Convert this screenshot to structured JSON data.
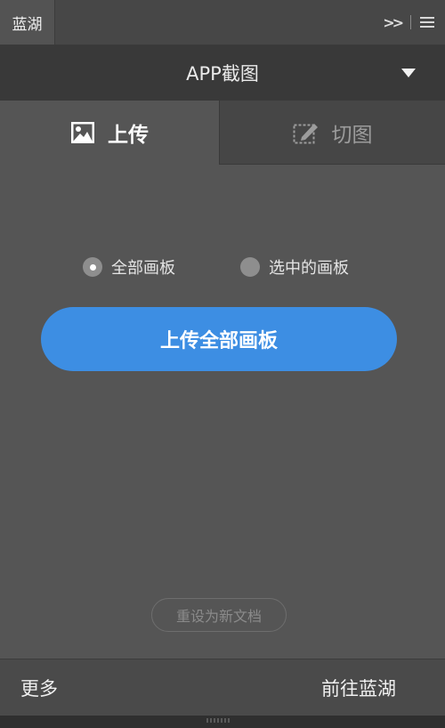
{
  "panel": {
    "tab_label": "蓝湖",
    "collapse_icon": "double-chevron-right-icon",
    "menu_icon": "hamburger-menu-icon"
  },
  "header": {
    "dropdown_label": "APP截图",
    "caret_icon": "caret-down-icon"
  },
  "mode_tabs": [
    {
      "label": "上传",
      "icon": "image-icon",
      "active": true
    },
    {
      "label": "切图",
      "icon": "slice-icon",
      "active": false
    }
  ],
  "options": {
    "selected": "全部画板",
    "items": [
      {
        "label": "全部画板",
        "checked": true
      },
      {
        "label": "选中的画板",
        "checked": false
      }
    ]
  },
  "actions": {
    "primary_label": "上传全部画板",
    "reset_label": "重设为新文档"
  },
  "footer": {
    "left_label": "更多",
    "right_label": "前往蓝湖"
  },
  "colors": {
    "accent": "#3d8ee3",
    "panel_bg": "#555555",
    "header_bg": "#393939"
  }
}
